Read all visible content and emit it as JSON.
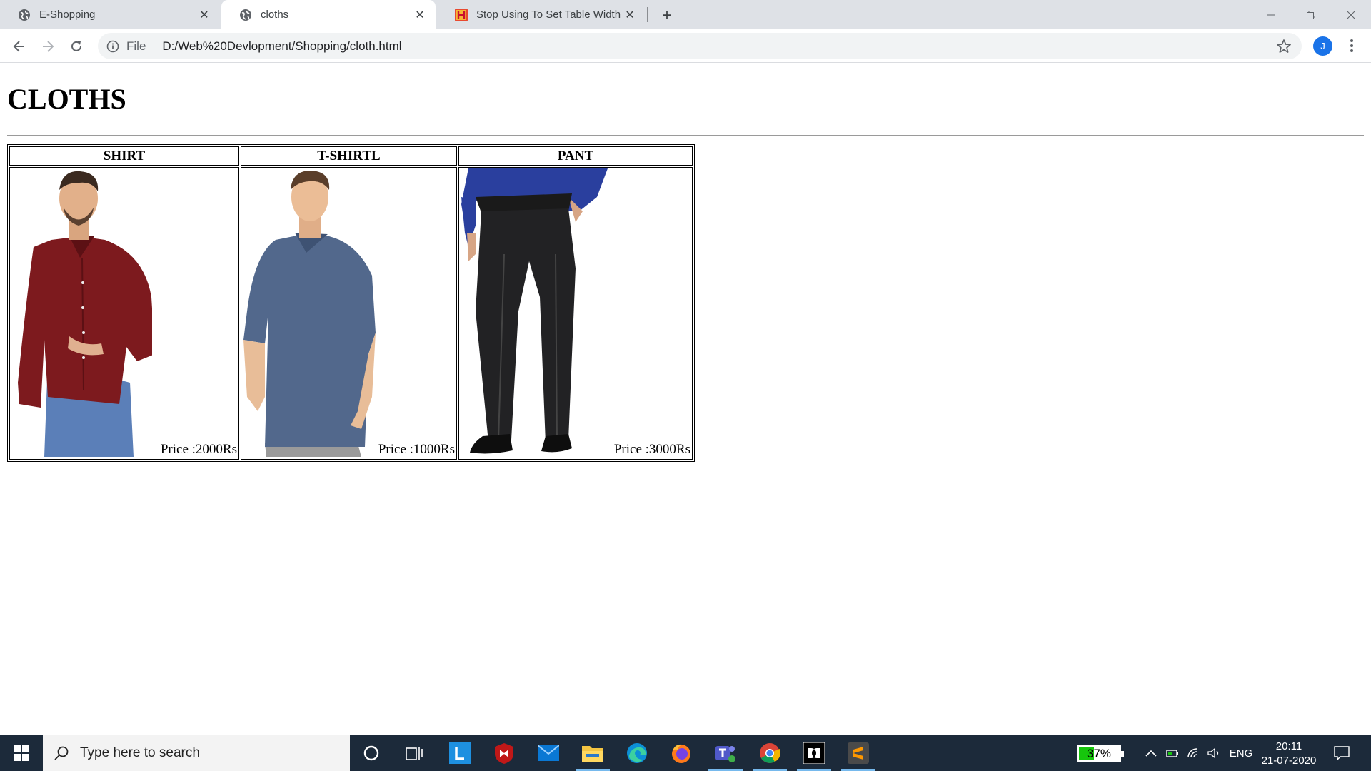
{
  "browser": {
    "tabs": [
      {
        "title": "E-Shopping",
        "icon": "globe-icon"
      },
      {
        "title": "cloths",
        "icon": "globe-icon"
      },
      {
        "title": "Stop Using To Set Table Width In",
        "icon": "h-logo-icon"
      }
    ],
    "address": {
      "scheme_label": "File",
      "url": "D:/Web%20Devlopment/Shopping/cloth.html"
    },
    "profile_initial": "J"
  },
  "page": {
    "heading": "CLOTHS",
    "columns": [
      {
        "header": "SHIRT",
        "price": "Price :2000Rs",
        "image": "red-shirt-photo"
      },
      {
        "header": "T-SHIRTL",
        "price": "Price :1000Rs",
        "image": "blue-tshirt-photo"
      },
      {
        "header": "PANT",
        "price": "Price :3000Rs",
        "image": "black-pant-photo"
      }
    ]
  },
  "taskbar": {
    "search_placeholder": "Type here to search",
    "battery_level": 0.37,
    "battery_text": "37%",
    "language": "ENG",
    "time": "20:11",
    "date": "21-07-2020",
    "pinned": [
      "cortana-icon",
      "task-view-icon",
      "l-app-icon",
      "mcafee-icon",
      "mail-icon",
      "file-explorer-icon",
      "edge-icon",
      "firefox-icon",
      "teams-icon",
      "chrome-icon",
      "dolby-icon",
      "sublime-icon"
    ]
  },
  "colors": {
    "tabstrip": "#dee1e6",
    "taskbar": "#1c2a3a",
    "accent": "#1a73e8"
  }
}
